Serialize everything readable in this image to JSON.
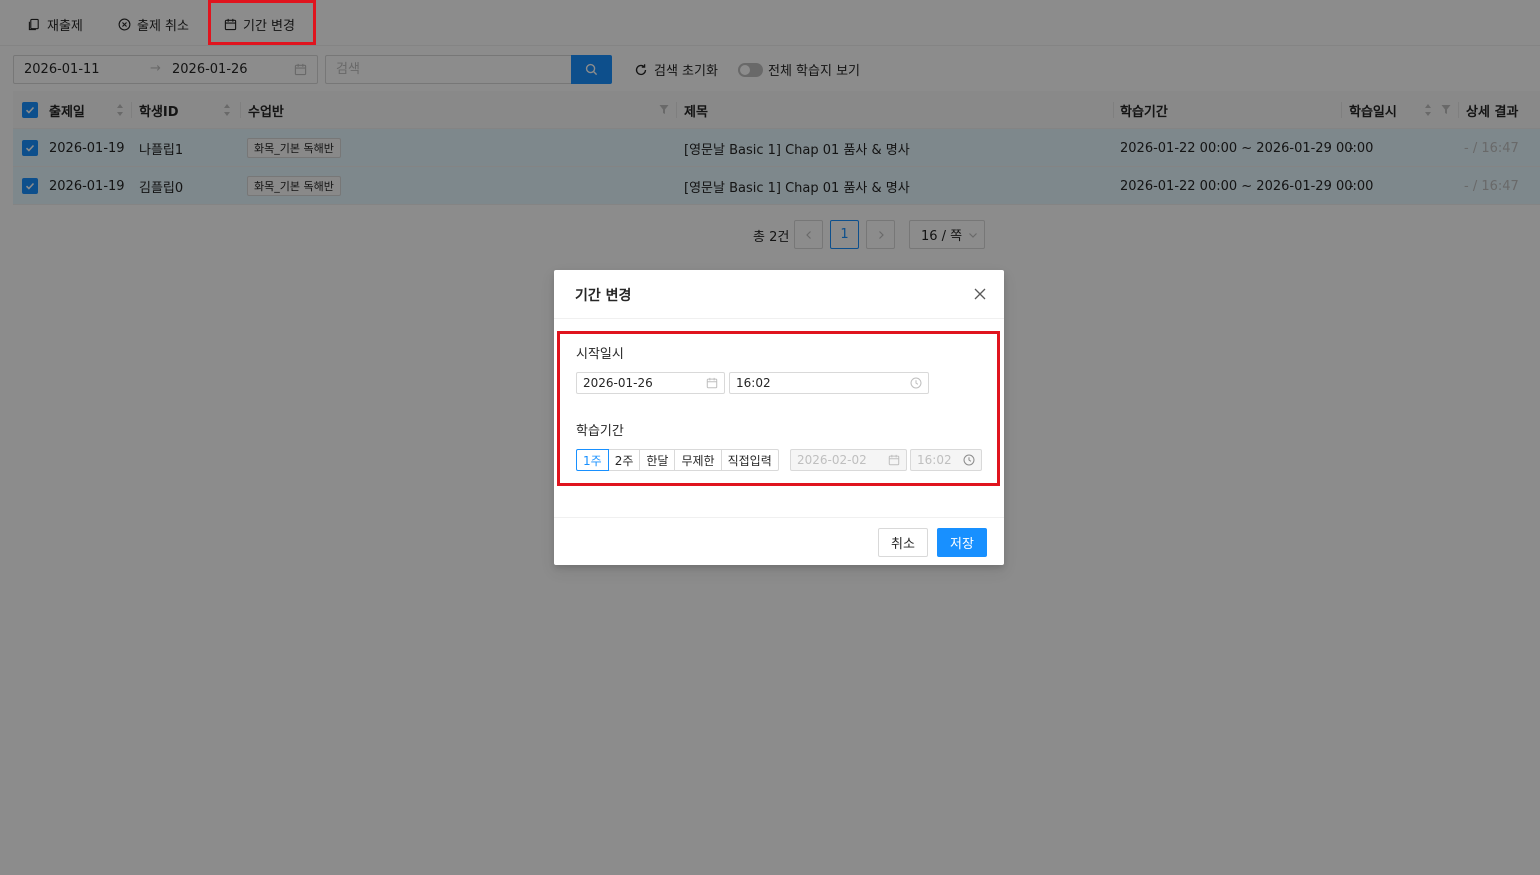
{
  "toolbar": {
    "reassign_label": "재출제",
    "cancel_assign_label": "출제 취소",
    "change_period_label": "기간 변경"
  },
  "filters": {
    "start_date": "2026-01-11",
    "range_arrow": "→",
    "end_date": "2026-01-26",
    "search_placeholder": "검색",
    "reset_label": "검색 초기화",
    "show_all_label": "전체 학습지 보기",
    "show_all_on": false
  },
  "table": {
    "headers": {
      "assign_date": "출제일",
      "student_id": "학생ID",
      "class": "수업반",
      "title": "제목",
      "study_period": "학습기간",
      "study_datetime": "학습일시",
      "detail_result": "상세 결과"
    },
    "rows": [
      {
        "assign_date": "2026-01-19",
        "student_id": "나플립1",
        "class": "화목_기본 독해반",
        "title": "[영문날 Basic 1] Chap 01 품사 & 명사",
        "study_period": "2026-01-22 00:00 ~ 2026-01-29 00:00",
        "study_datetime": "-",
        "detail_result": "- / 16:47"
      },
      {
        "assign_date": "2026-01-19",
        "student_id": "김플립0",
        "class": "화목_기본 독해반",
        "title": "[영문날 Basic 1] Chap 01 품사 & 명사",
        "study_period": "2026-01-22 00:00 ~ 2026-01-29 00:00",
        "study_datetime": "-",
        "detail_result": "- / 16:47"
      }
    ]
  },
  "pagination": {
    "total": "총 2건",
    "current_page": "1",
    "page_size": "16 / 쪽"
  },
  "modal": {
    "title": "기간 변경",
    "start_label": "시작일시",
    "start_date": "2026-01-26",
    "start_time": "16:02",
    "period_label": "학습기간",
    "period_options": [
      "1주",
      "2주",
      "한달",
      "무제한",
      "직접입력"
    ],
    "selected_period": "1주",
    "end_date": "2026-02-02",
    "end_time": "16:02",
    "cancel_label": "취소",
    "save_label": "저장"
  },
  "colors": {
    "primary": "#1890ff",
    "highlight": "#e0141e",
    "selected_row": "#e6f7ff",
    "mask": "rgba(0,0,0,0.45)"
  }
}
